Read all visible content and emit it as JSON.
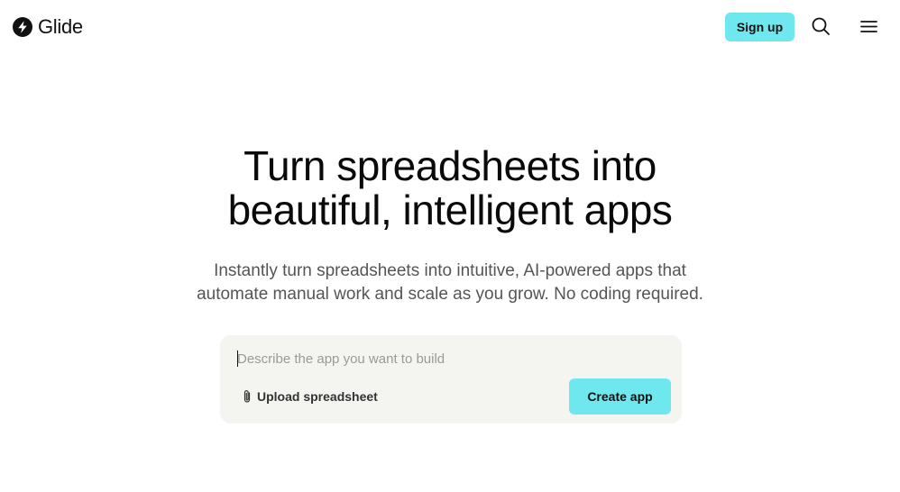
{
  "header": {
    "logo_text": "Glide",
    "signup_label": "Sign up",
    "search_icon": "search-icon",
    "menu_icon": "hamburger-menu-icon"
  },
  "hero": {
    "title_line1": "Turn spreadsheets into",
    "title_line2": "beautiful, intelligent apps",
    "subtitle_line1": "Instantly turn spreadsheets into intuitive, AI-powered apps that",
    "subtitle_line2": "automate manual work and scale as you grow. No coding required."
  },
  "prompt": {
    "placeholder": "Describe the app you want to build",
    "value": "",
    "upload_label": "Upload spreadsheet",
    "upload_icon": "paperclip-icon",
    "create_label": "Create app"
  },
  "colors": {
    "accent": "#6ee7ee",
    "card_background": "#f4f4f1",
    "text": "#111111",
    "subtitle": "#555555"
  }
}
